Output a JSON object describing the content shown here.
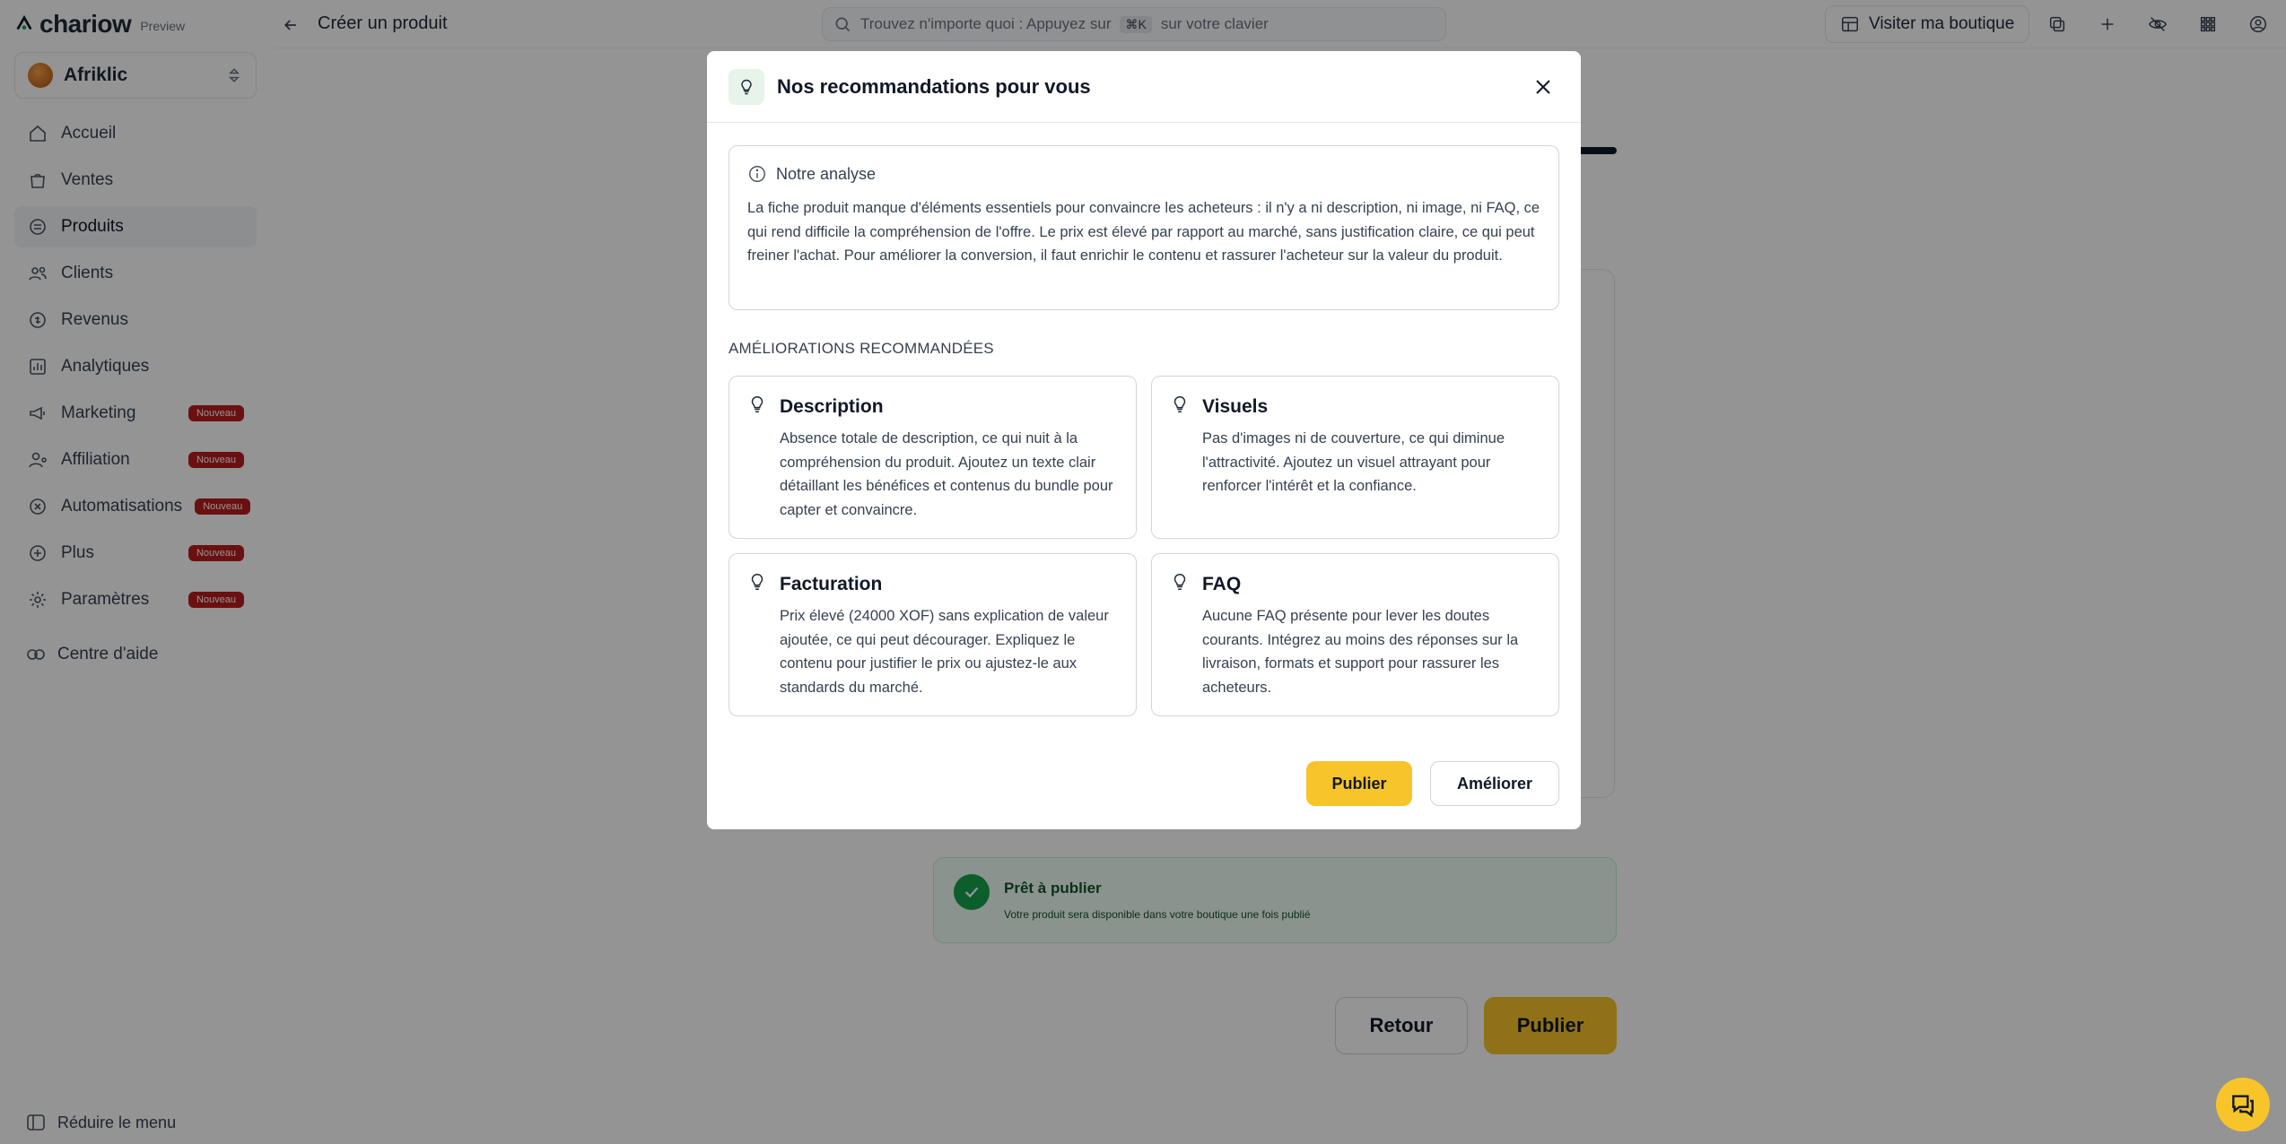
{
  "brand": {
    "logo_text": "chariow",
    "preview_label": "Preview"
  },
  "store": {
    "name": "Afriklic"
  },
  "sidebar": {
    "items": [
      {
        "label": "Accueil",
        "icon": "home-icon",
        "badge": ""
      },
      {
        "label": "Ventes",
        "icon": "shopping-bag-icon",
        "badge": ""
      },
      {
        "label": "Produits",
        "icon": "box-icon",
        "badge": "",
        "active": true
      },
      {
        "label": "Clients",
        "icon": "users-icon",
        "badge": ""
      },
      {
        "label": "Revenus",
        "icon": "revenue-icon",
        "badge": ""
      },
      {
        "label": "Analytiques",
        "icon": "chart-icon",
        "badge": ""
      },
      {
        "label": "Marketing",
        "icon": "megaphone-icon",
        "badge": "Nouveau"
      },
      {
        "label": "Affiliation",
        "icon": "user-network-icon",
        "badge": "Nouveau"
      },
      {
        "label": "Automatisations",
        "icon": "automation-icon",
        "badge": "Nouveau"
      },
      {
        "label": "Plus",
        "icon": "plus-circle-icon",
        "badge": "Nouveau"
      },
      {
        "label": "Paramètres",
        "icon": "gear-icon",
        "badge": "Nouveau"
      }
    ],
    "help_label": "Centre d'aide",
    "collapse_label": "Réduire le menu"
  },
  "topbar": {
    "page_title": "Créer un produit",
    "search_prefix": "Trouvez n'importe quoi : Appuyez sur",
    "search_shortcut": "⌘K",
    "search_suffix": "sur votre clavier",
    "visit_label": "Visiter ma boutique"
  },
  "background": {
    "ready_title": "Prêt à publier",
    "ready_subtitle": "Votre produit sera disponible dans votre boutique une fois publié",
    "back_label": "Retour",
    "publish_label": "Publier"
  },
  "modal": {
    "title": "Nos recommandations pour vous",
    "analysis_title": "Notre analyse",
    "analysis_text": "La fiche produit manque d'éléments essentiels pour convaincre les acheteurs : il n'y a ni description, ni image, ni FAQ, ce qui rend difficile la compréhension de l'offre. Le prix est élevé par rapport au marché, sans justification claire, ce qui peut freiner l'achat. Pour améliorer la conversion, il faut enrichir le contenu et rassurer l'acheteur sur la valeur du produit.",
    "section_label": "AMÉLIORATIONS RECOMMANDÉES",
    "recommendations": [
      {
        "title": "Description",
        "text": "Absence totale de description, ce qui nuit à la compréhension du produit. Ajoutez un texte clair détaillant les bénéfices et contenus du bundle pour capter et convaincre."
      },
      {
        "title": "Visuels",
        "text": "Pas d'images ni de couverture, ce qui diminue l'attractivité. Ajoutez un visuel attrayant pour renforcer l'intérêt et la confiance."
      },
      {
        "title": "Facturation",
        "text": "Prix élevé (24000 XOF) sans explication de valeur ajoutée, ce qui peut décourager. Expliquez le contenu pour justifier le prix ou ajustez-le aux standards du marché."
      },
      {
        "title": "FAQ",
        "text": "Aucune FAQ présente pour lever les doutes courants. Intégrez au moins des réponses sur la livraison, formats et support pour rassurer les acheteurs."
      }
    ],
    "publish_label": "Publier",
    "improve_label": "Améliorer"
  },
  "colors": {
    "accent": "#f7c52a",
    "badge": "#b91c1c",
    "success": "#16a34a",
    "overlay": "rgba(0,0,0,0.42)"
  }
}
